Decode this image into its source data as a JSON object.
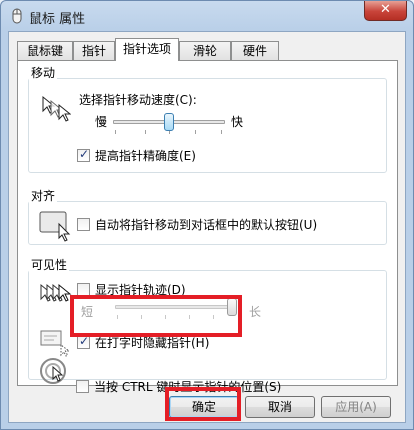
{
  "window": {
    "title": "鼠标 属性",
    "close_symbol": "✕"
  },
  "tabs": [
    {
      "label": "鼠标键",
      "active": false
    },
    {
      "label": "指针",
      "active": false
    },
    {
      "label": "指针选项",
      "active": true
    },
    {
      "label": "滑轮",
      "active": false
    },
    {
      "label": "硬件",
      "active": false
    }
  ],
  "motion": {
    "group_label": "移动",
    "speed_label": "选择指针移动速度(C):",
    "slow_label": "慢",
    "fast_label": "快",
    "speed_fraction": 0.5,
    "enhance_precision_label": "提高指针精确度(E)",
    "enhance_precision_checked": true
  },
  "snap": {
    "group_label": "对齐",
    "snap_to_label": "自动将指针移动到对话框中的默认按钮(U)",
    "snap_to_checked": false
  },
  "visibility": {
    "group_label": "可见性",
    "trails_label": "显示指针轨迹(D)",
    "trails_checked": false,
    "short_label": "短",
    "long_label": "长",
    "trails_fraction": 1.0,
    "hide_typing_label": "在打字时隐藏指针(H)",
    "hide_typing_checked": true,
    "show_ctrl_label": "当按 CTRL 键时显示指针的位置(S)",
    "show_ctrl_checked": false
  },
  "buttons": {
    "ok": "确定",
    "cancel": "取消",
    "apply": "应用(A)"
  },
  "colors": {
    "highlight_red": "#e41e26",
    "title_bar": "#b9cfe8",
    "close_red": "#c8443a"
  }
}
